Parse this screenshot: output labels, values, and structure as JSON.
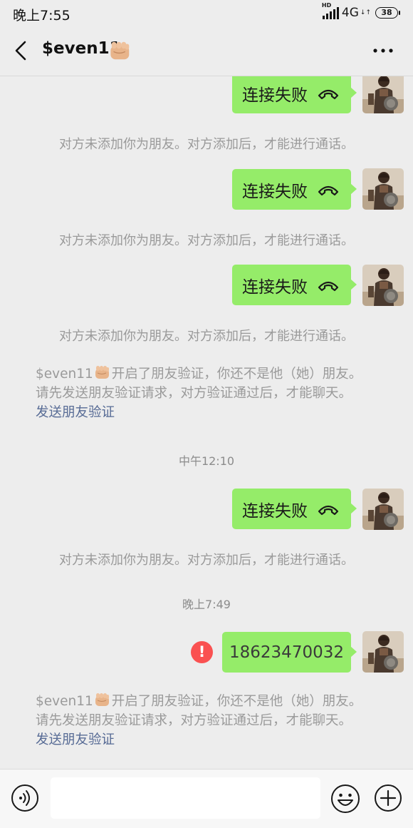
{
  "status_bar": {
    "time": "晚上7:55",
    "network": "4G",
    "hd": "HD",
    "net_arrows": "↓↑",
    "battery": "38"
  },
  "header": {
    "title": "$even11",
    "title_emoji": "fist-emoji",
    "back_icon": "chevron-left-icon",
    "more_icon": "more-dots-icon"
  },
  "messages": {
    "call_failed_1": "连接失败",
    "sys_1": "对方未添加你为朋友。对方添加后，才能进行通话。",
    "call_failed_2": "连接失败",
    "sys_2": "对方未添加你为朋友。对方添加后，才能进行通话。",
    "call_failed_3": "连接失败",
    "sys_3": "对方未添加你为朋友。对方添加后，才能进行通话。",
    "verify_1": {
      "name": "$even11",
      "line1_rest": "开启了朋友验证，你还不是他（她）朋友。",
      "line2": "请先发送朋友验证请求，对方验证通过后，才能聊天。",
      "link": "发送朋友验证"
    },
    "time_1": "中午12:10",
    "call_failed_4": "连接失败",
    "sys_4": "对方未添加你为朋友。对方添加后，才能进行通话。",
    "time_2": "晚上7:49",
    "number_message": "18623470032",
    "error_mark": "!",
    "verify_2": {
      "name": "$even11",
      "line1_rest": "开启了朋友验证，你还不是他（她）朋友。",
      "line2": "请先发送朋友验证请求，对方验证通过后，才能聊天。",
      "link": "发送朋友验证"
    }
  },
  "input_bar": {
    "placeholder": "",
    "voice_icon": "voice-icon",
    "emoji_icon": "emoji-icon",
    "plus_icon": "plus-icon"
  },
  "colors": {
    "background": "#ededed",
    "bubble": "#95ec69",
    "link": "#576b95",
    "error": "#fa5151",
    "system_text": "#9a9a9a"
  }
}
